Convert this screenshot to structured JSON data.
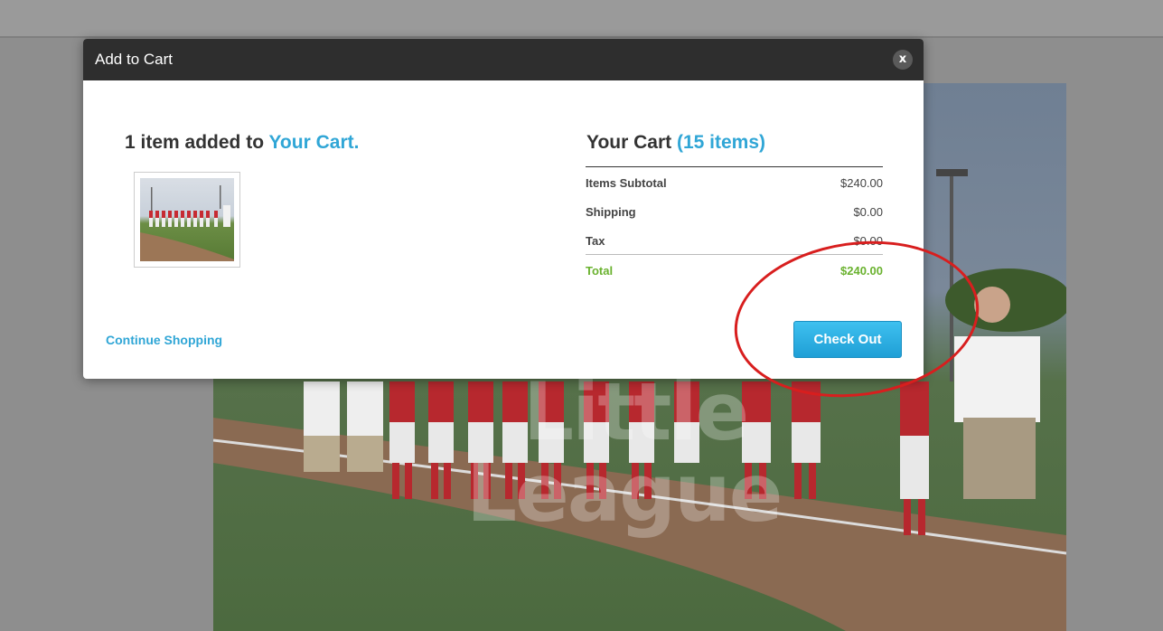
{
  "modal": {
    "title": "Add to Cart",
    "close_label": "x",
    "added_prefix": "1 item added to ",
    "added_link": "Your Cart.",
    "cart_heading": "Your Cart",
    "cart_count": "(15 items)",
    "summary": {
      "subtotal_label": "Items Subtotal",
      "subtotal_value": "$240.00",
      "shipping_label": "Shipping",
      "shipping_value": "$0.00",
      "tax_label": "Tax",
      "tax_value": "$0.00",
      "total_label": "Total",
      "total_value": "$240.00"
    },
    "continue_label": "Continue Shopping",
    "checkout_label": "Check Out"
  },
  "background": {
    "watermark_line1": "Little",
    "watermark_line2": "League"
  },
  "colors": {
    "accent": "#30a6d6",
    "total_green": "#6ab22f",
    "header_dark": "#2e2e2e",
    "annotation_red": "#d81e1e"
  }
}
